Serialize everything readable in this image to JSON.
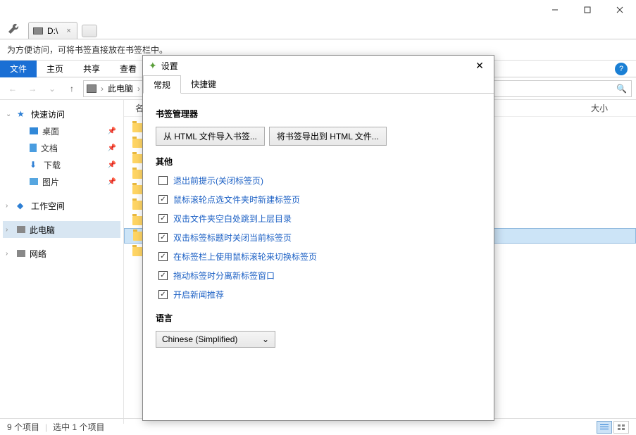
{
  "titlebar": {
    "path": "D:\\"
  },
  "tab": {
    "label": "D:\\"
  },
  "infobar": {
    "text": "为方便访问，可将书签直接放在书签栏中。"
  },
  "ribbon": {
    "file": "文件",
    "home": "主页",
    "share": "共享",
    "view": "查看"
  },
  "address": {
    "this_pc": "此电脑"
  },
  "columns": {
    "name": "名称",
    "size": "大小"
  },
  "sidebar": {
    "quick": "快速访问",
    "desktop": "桌面",
    "documents": "文档",
    "downloads": "下载",
    "pictures": "图片",
    "workspace": "工作空间",
    "this_pc": "此电脑",
    "network": "网络"
  },
  "status": {
    "count": "9 个项目",
    "selected": "选中 1 个项目"
  },
  "dialog": {
    "title": "设置",
    "tab_general": "常规",
    "tab_hotkey": "快捷键",
    "section_bookmark": "书签管理器",
    "btn_import": "从 HTML 文件导入书签...",
    "btn_export": "将书签导出到 HTML 文件...",
    "section_other": "其他",
    "chk1": "退出前提示(关闭标签页)",
    "chk2": "鼠标滚轮点选文件夹时新建标签页",
    "chk3": "双击文件夹空白处跳到上层目录",
    "chk4": "双击标签标题时关闭当前标签页",
    "chk5": "在标签栏上使用鼠标滚轮来切换标签页",
    "chk6": "拖动标签时分离新标签窗口",
    "chk7": "开启新闻推荐",
    "section_lang": "语言",
    "lang_value": "Chinese (Simplified)"
  }
}
